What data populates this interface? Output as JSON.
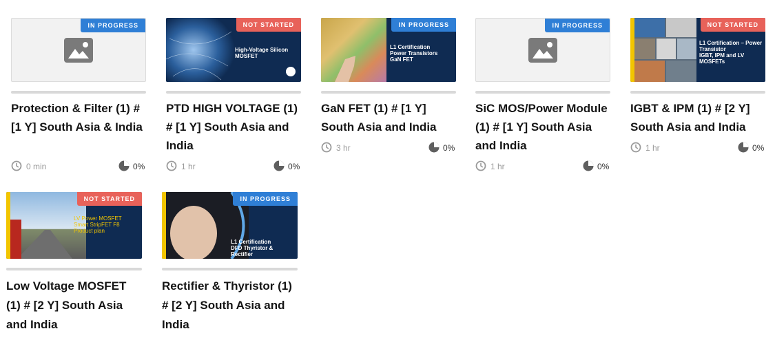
{
  "courses": [
    {
      "status": "IN PROGRESS",
      "title": "Protection & Filter (1) # [1 Y] South Asia & India",
      "duration": "0 min",
      "progress": "0%",
      "thumbnail": "image-placeholder-icon"
    },
    {
      "status": "NOT STARTED",
      "title": "PTD HIGH VOLTAGE (1) # [1 Y] South Asia and India",
      "duration": "1 hr",
      "progress": "0%",
      "thumbnail_text": "High-Voltage Silicon MOSFET"
    },
    {
      "status": "IN PROGRESS",
      "title": "GaN FET (1) # [1 Y] South Asia and India",
      "duration": "3 hr",
      "progress": "0%",
      "thumbnail_text": "L1 Certification\nPower Transistors\nGaN FET"
    },
    {
      "status": "IN PROGRESS",
      "title": "SiC MOS/Power Module (1) # [1 Y] South Asia and India",
      "duration": "1 hr",
      "progress": "0%",
      "thumbnail": "image-placeholder-icon"
    },
    {
      "status": "NOT STARTED",
      "title": "IGBT & IPM (1) # [2 Y] South Asia and India",
      "duration": "1 hr",
      "progress": "0%",
      "thumbnail_text": "L1 Certification – Power Transistor\nIGBT, IPM and LV MOSFETs"
    },
    {
      "status": "NOT STARTED",
      "title": "Low Voltage MOSFET (1) # [2 Y] South Asia and India",
      "thumbnail_text": "LV Power MOSFET\nSmart StripFET F8\nProduct plan"
    },
    {
      "status": "IN PROGRESS",
      "title": "Rectifier & Thyristor (1) # [2 Y] South Asia and India",
      "thumbnail_text": "L1 Certification\nDFD Thyristor & Rectifier"
    }
  ],
  "colors": {
    "in_progress": "#2f7fd6",
    "not_started": "#e8625a",
    "slide_navy": "#0f2b52",
    "accent_yellow": "#f2c500"
  },
  "icons": {
    "duration": "clock-icon",
    "progress": "pie-progress-icon"
  }
}
